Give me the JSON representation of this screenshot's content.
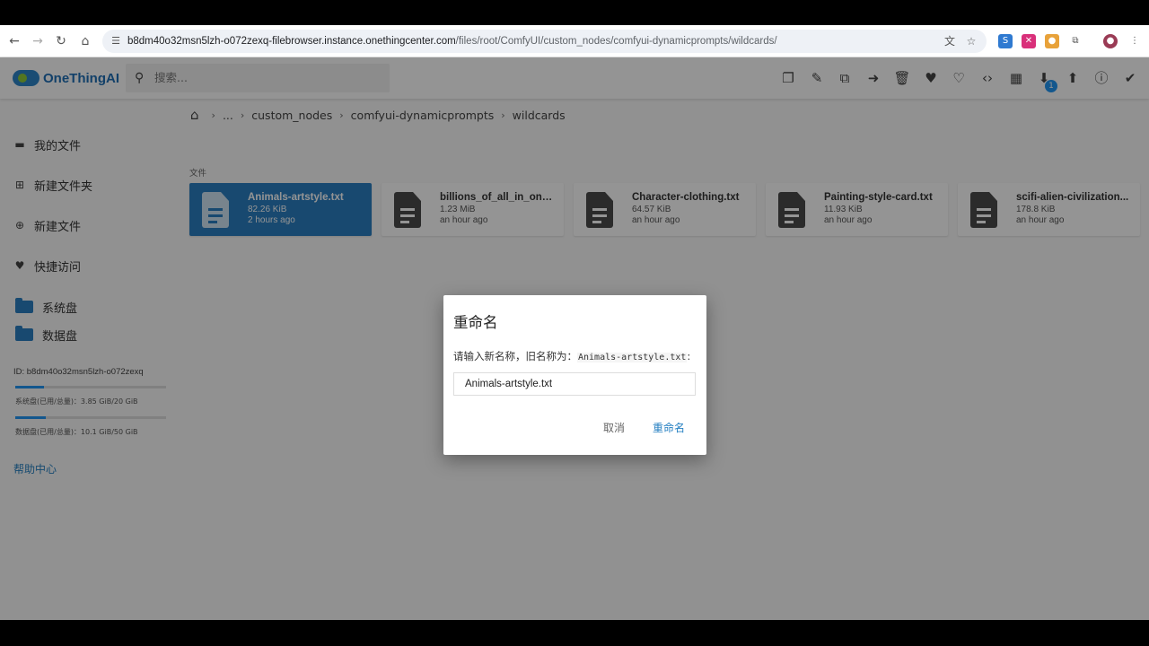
{
  "browser": {
    "url_host": "b8dm40o32msn5lzh-o072zexq-filebrowser.instance.onethingcenter.com",
    "url_path": "/files/root/ComfyUI/custom_nodes/comfyui-dynamicprompts/wildcards/",
    "extension_badge": "1"
  },
  "app": {
    "logo_text": "OneThingAI",
    "search_placeholder": "搜索..."
  },
  "sidebar": {
    "items": [
      {
        "label": "我的文件",
        "icon": "folder-icon"
      },
      {
        "label": "新建文件夹",
        "icon": "add-folder-icon"
      },
      {
        "label": "新建文件",
        "icon": "add-file-icon"
      },
      {
        "label": "快捷访问",
        "icon": "heart-icon"
      }
    ],
    "disks": [
      {
        "label": "系统盘"
      },
      {
        "label": "数据盘"
      }
    ],
    "instance_id": "ID: b8dm40o32msn5lzh-o072zexq",
    "usage": [
      {
        "label": "系统盘(已用/总量)：3.85 GiB/20 GiB",
        "fraction": 0.19
      },
      {
        "label": "数据盘(已用/总量)：10.1 GiB/50 GiB",
        "fraction": 0.2
      }
    ],
    "help": "帮助中心"
  },
  "breadcrumb": {
    "items": [
      "...",
      "custom_nodes",
      "comfyui-dynamicprompts",
      "wildcards"
    ]
  },
  "files": {
    "section_label": "文件",
    "items": [
      {
        "name": "Animals-artstyle.txt",
        "size": "82.26 KiB",
        "time": "2 hours ago",
        "selected": true
      },
      {
        "name": "billions_of_all_in_one....",
        "size": "1.23 MiB",
        "time": "an hour ago",
        "selected": false
      },
      {
        "name": "Character-clothing.txt",
        "size": "64.57 KiB",
        "time": "an hour ago",
        "selected": false
      },
      {
        "name": "Painting-style-card.txt",
        "size": "11.93 KiB",
        "time": "an hour ago",
        "selected": false
      },
      {
        "name": "scifi-alien-civilization...",
        "size": "178.8 KiB",
        "time": "an hour ago",
        "selected": false
      }
    ]
  },
  "dialog": {
    "title": "重命名",
    "prompt": "请输入新名称，旧名称为：",
    "old_name": "Animals-artstyle.txt",
    "prompt_suffix": ":",
    "input_value": "Animals-artstyle.txt",
    "cancel": "取消",
    "confirm": "重命名"
  },
  "colors": {
    "accent": "#2a7fc1",
    "link": "#2680c2",
    "badge": "#2196f3"
  }
}
